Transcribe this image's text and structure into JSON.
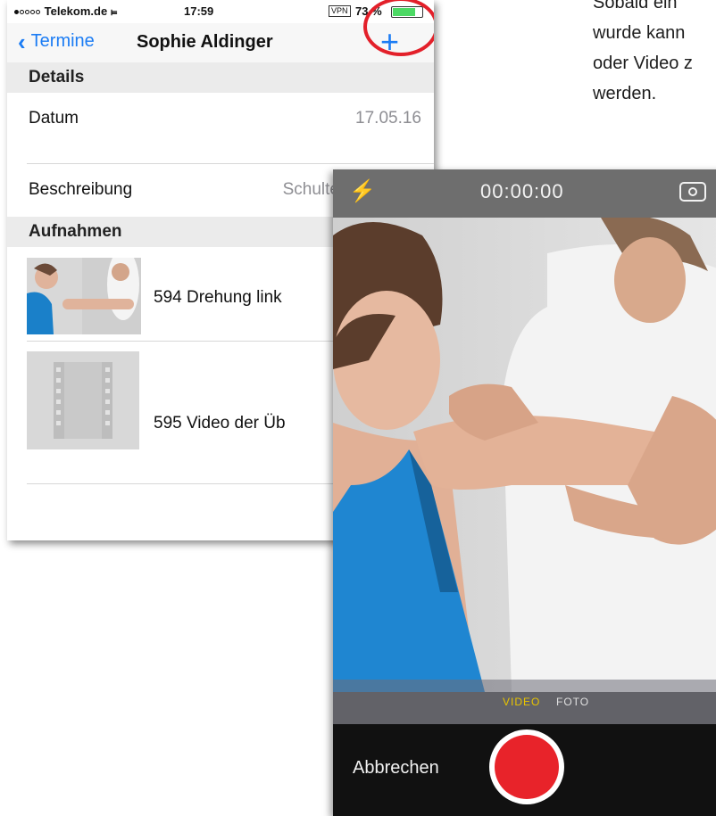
{
  "status_bar": {
    "carrier": "Telekom.de",
    "time": "17:59",
    "vpn": "VPN",
    "battery": "73 %",
    "battery_level": 0.73
  },
  "nav": {
    "back_label": "Termine",
    "title": "Sophie Aldinger",
    "add_symbol": "+"
  },
  "details": {
    "section_title": "Details",
    "rows": [
      {
        "label": "Datum",
        "value": "17.05.16"
      },
      {
        "label": "Beschreibung",
        "value": "Schulte"
      }
    ]
  },
  "recordings": {
    "section_title": "Aufnahmen",
    "items": [
      {
        "title": "594  Drehung link",
        "thumb": "photo"
      },
      {
        "title": "595  Video der Üb",
        "thumb": "video-placeholder"
      }
    ]
  },
  "paragraph": {
    "lines": [
      "Sobald  ein",
      "wurde kann",
      "oder Video z",
      "werden."
    ]
  },
  "camera": {
    "timer": "00:00:00",
    "mode_video": "VIDEO",
    "mode_foto": "FOTO",
    "cancel_label": "Abbrechen"
  },
  "colors": {
    "accent": "#1b7cf4",
    "highlight_ring": "#e3202a",
    "record": "#e8232a"
  }
}
